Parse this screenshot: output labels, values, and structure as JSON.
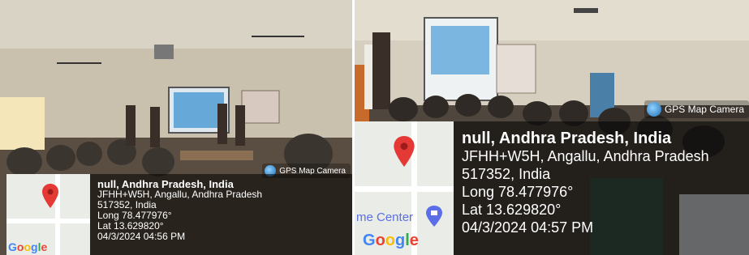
{
  "photos": [
    {
      "id": "left",
      "badge": "GPS Map Camera",
      "map_logo": "Google",
      "title": "null, Andhra Pradesh, India",
      "address_line1": "JFHH+W5H, Angallu, Andhra Pradesh",
      "address_line2": "517352, India",
      "longitude": "Long 78.477976°",
      "latitude": "Lat 13.629820°",
      "datetime": "04/3/2024 04:56 PM"
    },
    {
      "id": "right",
      "badge": "GPS Map Camera",
      "map_logo": "Google",
      "map_place_label": "me Center",
      "title": "null, Andhra Pradesh, India",
      "address_line1": "JFHH+W5H, Angallu, Andhra Pradesh",
      "address_line2": "517352, India",
      "longitude": "Long 78.477976°",
      "latitude": "Lat 13.629820°",
      "datetime": "04/3/2024 04:57 PM"
    }
  ],
  "colors": {
    "pin": "#e53935",
    "overlay": "#000000"
  }
}
